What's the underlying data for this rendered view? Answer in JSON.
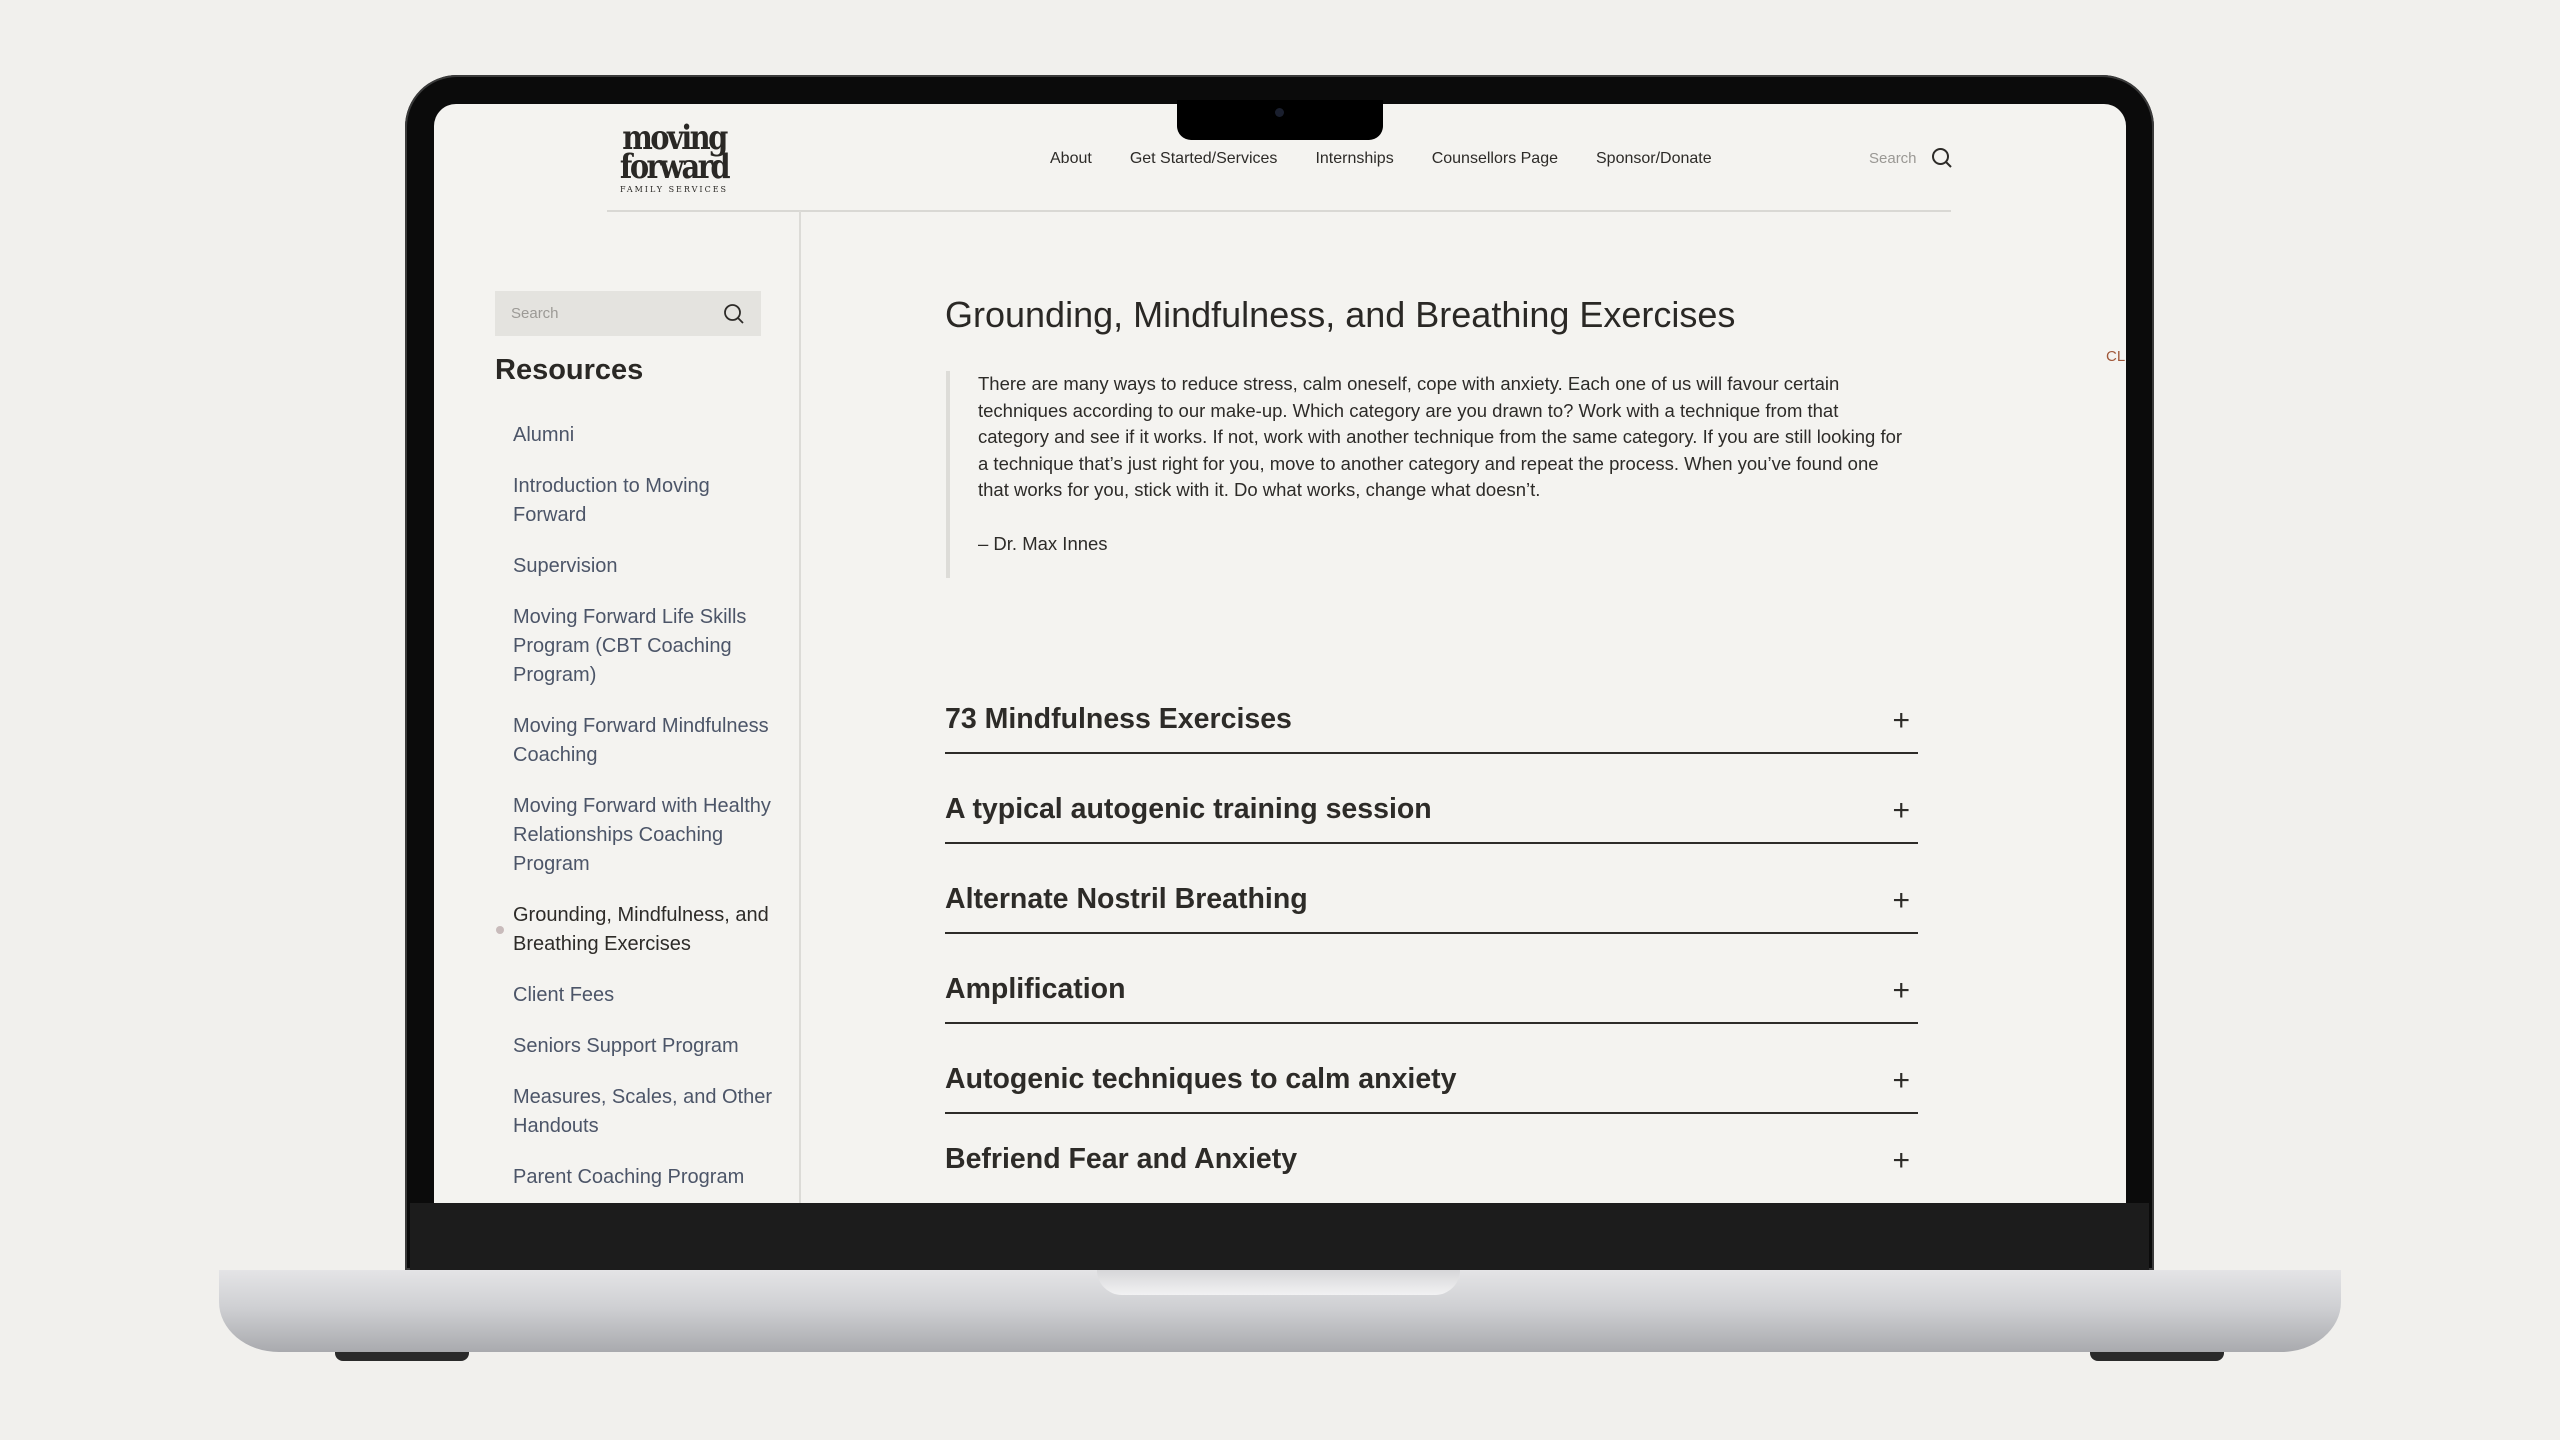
{
  "logo": {
    "line1": "moving",
    "line2": "forward",
    "tagline": "FAMILY SERVICES"
  },
  "nav": {
    "items": [
      "About",
      "Get Started/Services",
      "Internships",
      "Counsellors Page",
      "Sponsor/Donate"
    ],
    "search_placeholder": "Search"
  },
  "sidebar": {
    "search_placeholder": "Search",
    "title": "Resources",
    "items": [
      {
        "label": "Alumni"
      },
      {
        "label": "Introduction to Moving Forward"
      },
      {
        "label": "Supervision"
      },
      {
        "label": "Moving Forward Life Skills Program (CBT Coaching Program)"
      },
      {
        "label": "Moving Forward Mindfulness Coaching"
      },
      {
        "label": "Moving Forward with Healthy Relationships Coaching Program"
      },
      {
        "label": "Grounding, Mindfulness, and Breathing Exercises",
        "active": true
      },
      {
        "label": "Client Fees"
      },
      {
        "label": "Seniors Support Program"
      },
      {
        "label": "Measures, Scales, and Other Handouts"
      },
      {
        "label": "Parent Coaching Program"
      }
    ]
  },
  "main": {
    "title": "Grounding, Mindfulness, and Breathing Exercises",
    "quote": "There are many ways to reduce stress, calm oneself, cope with anxiety. Each one of us will favour certain techniques according to our make-up. Which category are you drawn to? Work with a technique from that category and see if it works. If not, work with another technique from the same category. If you are still looking for a technique that’s just right for you, move to another category and repeat the process. When you’ve found one that works for you, stick with it. Do what works, change what doesn’t.",
    "quote_author": "– Dr. Max Innes",
    "side_fragment": "CL",
    "accordion": [
      "73 Mindfulness Exercises",
      "A typical autogenic training session",
      "Alternate Nostril Breathing",
      "Amplification",
      "Autogenic techniques to calm anxiety",
      "Befriend Fear and Anxiety"
    ],
    "expand_symbol": "+"
  },
  "colors": {
    "background": "#f4f3f0",
    "sidebar_link": "#4c5568",
    "text": "#2d2b28"
  }
}
